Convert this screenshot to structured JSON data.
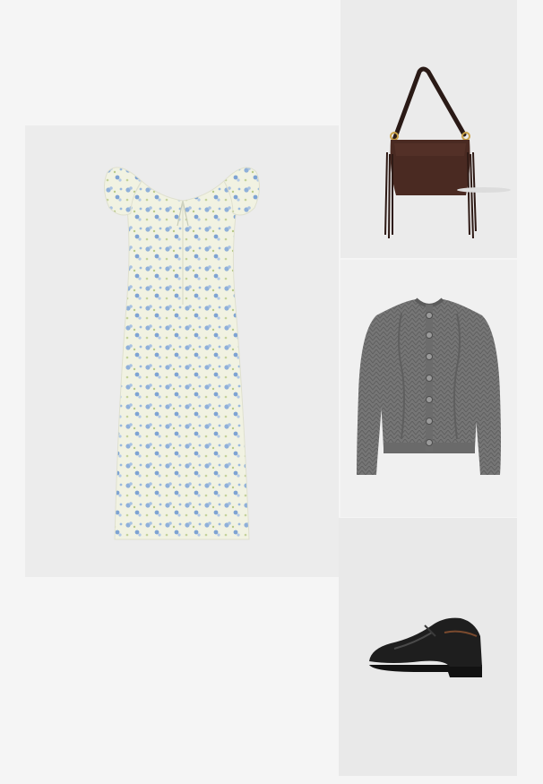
{
  "items": [
    {
      "name": "floral-midi-dress",
      "dominant_color": "#eef0dc",
      "pattern_color": "#8fb0d9"
    },
    {
      "name": "leather-fringe-bag",
      "dominant_color": "#4a2a22"
    },
    {
      "name": "grey-cable-knit-cardigan",
      "dominant_color": "#717171"
    },
    {
      "name": "black-leather-loafer",
      "dominant_color": "#1e1e1e"
    }
  ]
}
